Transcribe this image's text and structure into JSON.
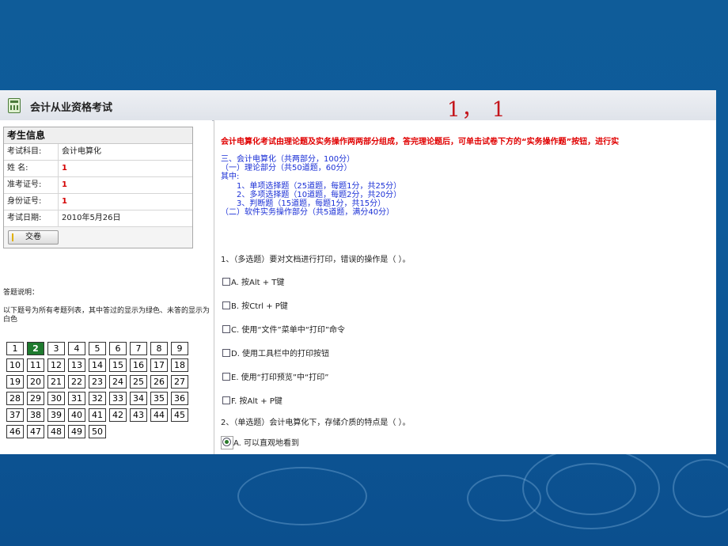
{
  "app": {
    "title": "会计从业资格考试",
    "page_counter": "1， 1"
  },
  "candidate": {
    "header": "考生信息",
    "rows": [
      {
        "label": "考试科目:",
        "value": "会计电算化"
      },
      {
        "label": "姓  名:",
        "value": "1"
      },
      {
        "label": "准考证号:",
        "value": "1"
      },
      {
        "label": "身份证号:",
        "value": "1"
      },
      {
        "label": "考试日期:",
        "value": "2010年5月26日"
      }
    ],
    "submit_label": "交卷"
  },
  "answer_help": {
    "title": "答题说明：",
    "description": "以下题号为所有考题列表，其中答过的显示为绿色、未答的显示为白色"
  },
  "question_numbers": [
    "1",
    "2",
    "3",
    "4",
    "5",
    "6",
    "7",
    "8",
    "9",
    "10",
    "11",
    "12",
    "13",
    "14",
    "15",
    "16",
    "17",
    "18",
    "19",
    "20",
    "21",
    "22",
    "23",
    "24",
    "25",
    "26",
    "27",
    "28",
    "29",
    "30",
    "31",
    "32",
    "33",
    "34",
    "35",
    "36",
    "37",
    "38",
    "39",
    "40",
    "41",
    "42",
    "43",
    "44",
    "45",
    "46",
    "47",
    "48",
    "49",
    "50"
  ],
  "answered": [
    "2"
  ],
  "intro": {
    "notice": "会计电算化考试由理论题及实务操作两两部分组成，答完理论题后，可单击试卷下方的“实务操作题”按钮，进行实",
    "lines": [
      "三、会计电算化（共两部分，100分）",
      "（一）理论部分（共50道题，60分）",
      "其中:",
      "    1、单项选择题（25道题，每题1分，共25分）",
      "    2、多项选择题（10道题，每题2分，共20分）",
      "    3、判断题（15道题，每题1分，共15分）",
      "（二）软件实务操作部分（共5道题，满分40分）"
    ]
  },
  "question1": {
    "text": "1、（多选题）要对文档进行打印，错误的操作是（ ）。",
    "options": [
      "A. 按Alt + T键",
      "B. 按Ctrl + P键",
      "C. 使用“文件”菜单中“打印”命令",
      "D. 使用工具栏中的打印按钮",
      "E. 使用“打印预览”中“打印”",
      "F. 按Alt + P键"
    ]
  },
  "question2": {
    "text": "2、（单选题）会计电算化下，存储介质的特点是（ ）。",
    "option_a": "A. 可以直观地看到"
  },
  "colors": {
    "background": "#0d5a9a",
    "accent_red": "#e00000",
    "intro_blue": "#1a2fd6",
    "answered_green": "#1e7a2e"
  }
}
